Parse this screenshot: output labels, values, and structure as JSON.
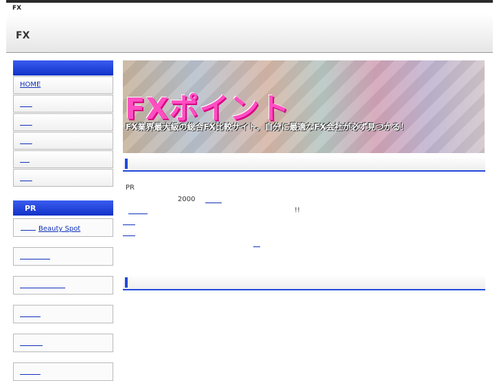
{
  "topbar": {
    "label": "FX"
  },
  "header": {
    "title": "FX"
  },
  "sidebar": {
    "nav_heading": "",
    "items": [
      {
        "label": "HOME"
      },
      {
        "label": ""
      },
      {
        "label": ""
      },
      {
        "label": ""
      },
      {
        "label": ""
      },
      {
        "label": ""
      }
    ],
    "pr_heading": "PR",
    "pr_items": [
      {
        "label": "Beauty Spot"
      },
      {
        "label": ""
      },
      {
        "label": ""
      },
      {
        "label": ""
      },
      {
        "label": ""
      },
      {
        "label": ""
      }
    ]
  },
  "banner": {
    "title": "FXポイント",
    "subtitle": "FX業界最大級の総合FX比較サイト。自分に最適なFX会社が必ず見つかる！"
  },
  "main": {
    "section1_title": "",
    "pr_label": "PR",
    "year_text": "2000",
    "exclaim": "!!",
    "section2_title": ""
  },
  "colors": {
    "accent": "#1f48dc",
    "link": "#0b2fb8",
    "banner_title": "#ff4fc1"
  }
}
